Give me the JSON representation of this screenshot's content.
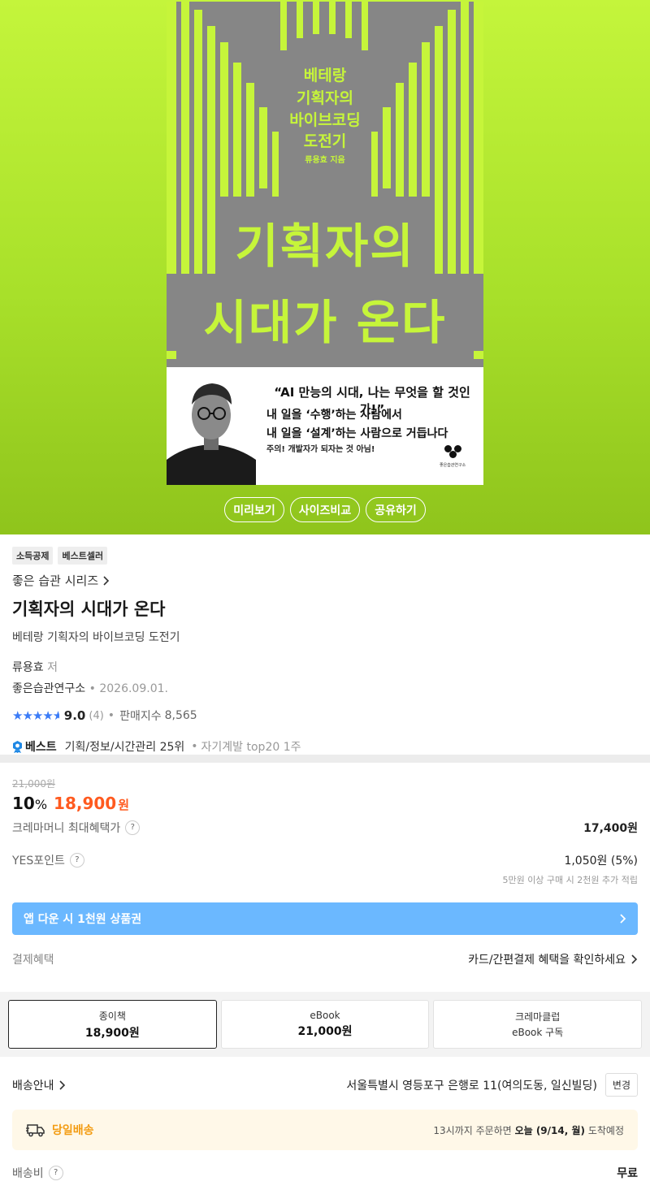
{
  "cover": {
    "small_title_lines": [
      "베테랑",
      "기획자의",
      "바이브코딩",
      "도전기"
    ],
    "author": "류용효 지음",
    "big_title_line1": "기획자의",
    "big_title_line2": "시대가 온다",
    "quote": "“AI 만능의 시대, 나는 무엇을 할 것인가!”",
    "line1": "내 일을 ‘수행’하는 사람에서",
    "line2": "내 일을 ‘설계’하는 사람으로 거듭나다",
    "warning": "주의! 개발자가 되자는 것 아님!",
    "publisher_mark": "좋은습관연구소"
  },
  "hero_buttons": {
    "preview": "미리보기",
    "size_compare": "사이즈비교",
    "share": "공유하기"
  },
  "badges": [
    "소득공제",
    "베스트셀러"
  ],
  "series": "좋은 습관 시리즈",
  "title": "기획자의 시대가 온다",
  "subtitle": "베테랑 기획자의 바이브코딩 도전기",
  "author": {
    "name": "류용효",
    "role": "저"
  },
  "publisher": {
    "name": "좋은습관연구소",
    "sep": "•",
    "date": "2026.09.01."
  },
  "rating": {
    "stars_value": 4.5,
    "score": "9.0",
    "count": "(4)",
    "sep": "•",
    "sales_label": "판매지수",
    "sales": "8,565"
  },
  "best": {
    "label": "베스트",
    "rank1": "기획/정보/시간관리 25위",
    "sep": "•",
    "rank2": "자기계발 top20 1주"
  },
  "price": {
    "original": "21,000원",
    "discount": "10",
    "discount_unit": "%",
    "sale": "18,900",
    "sale_unit": "원",
    "crema_label": "크레마머니 최대혜택가",
    "crema_value": "17,400원",
    "yes_label": "YES포인트",
    "yes_value": "1,050원 (5%)",
    "yes_note": "5만원 이상 구매 시 2천원 추가 적립",
    "app_banner": "앱 다운 시 1천원 상품권",
    "payment_label": "결제혜택",
    "payment_value": "카드/간편결제 혜택을 확인하세요"
  },
  "formats": [
    {
      "name": "종이책",
      "price": "18,900원"
    },
    {
      "name": "eBook",
      "price": "21,000원"
    },
    {
      "name": "크레마클럽",
      "price": "eBook 구독"
    }
  ],
  "delivery": {
    "label": "배송안내",
    "address": "서울특별시 영등포구 은행로 11(여의도동, 일신빌딩)",
    "change": "변경",
    "sameday_label": "당일배송",
    "sameday_pre": "13시까지 주문하면",
    "sameday_date": "오늘 (9/14, 월)",
    "sameday_post": "도착예정",
    "fee_label": "배송비",
    "fee_value": "무료"
  },
  "colors": {
    "accent_green": "#c4f53b",
    "sale_orange": "#ff5a1f",
    "star_blue": "#3a7bf7",
    "banner_blue": "#6bb8ff"
  }
}
